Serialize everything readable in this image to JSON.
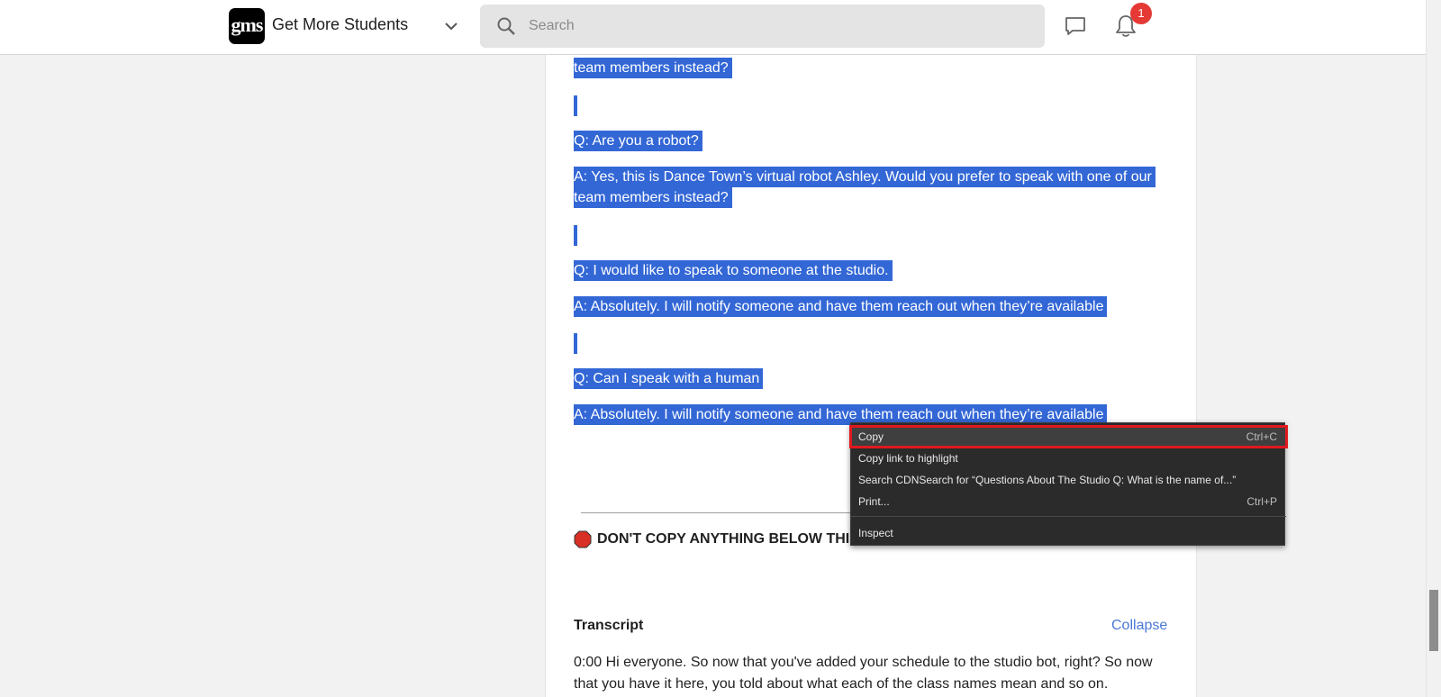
{
  "header": {
    "logo_text": "gms",
    "brand": "Get More Students",
    "search_placeholder": "Search",
    "notification_count": "1"
  },
  "content": {
    "lines": [
      "team members instead?",
      "Q: Are you a robot?",
      "A: Yes, this is Dance Town’s virtual robot Ashley. Would you prefer to speak with one of our",
      "team members instead?",
      "Q: I would like to speak to someone at the studio.",
      "A: Absolutely. I will notify someone and have them reach out when they’re available",
      "Q: Can I speak with a human",
      "A: Absolutely. I will notify someone and have them reach out when they’re available"
    ],
    "dont_copy": "DON'T COPY ANYTHING BELOW THIS V",
    "transcript_title": "Transcript",
    "collapse_label": "Collapse",
    "transcript_text": "0:00 Hi everyone. So now that you've added your schedule to the studio bot, right? So now that you have it here, you told about what each of the class names mean and so on."
  },
  "context_menu": {
    "items": [
      {
        "label": "Copy",
        "shortcut": "Ctrl+C"
      },
      {
        "label": "Copy link to highlight",
        "shortcut": ""
      },
      {
        "label": "Search CDNSearch for “Questions About The Studio Q: What is the name of...”",
        "shortcut": ""
      },
      {
        "label": "Print...",
        "shortcut": "Ctrl+P"
      },
      {
        "label": "Inspect",
        "shortcut": ""
      }
    ]
  },
  "colors": {
    "selection": "#3367d6",
    "highlight_outline": "#e0191f",
    "link": "#4b78d6",
    "badge": "#e53935"
  }
}
